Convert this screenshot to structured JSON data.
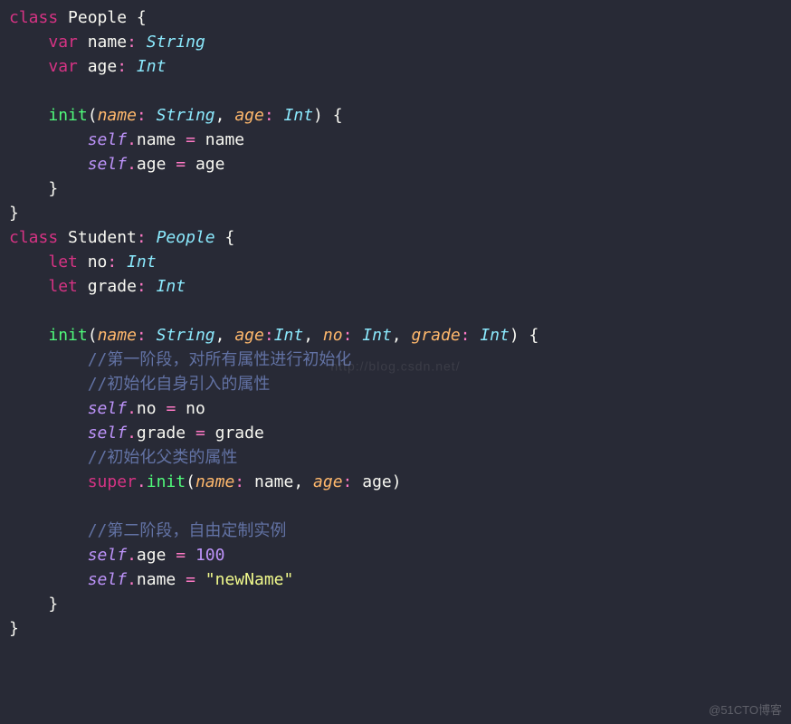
{
  "code": {
    "line1": {
      "class": "class",
      "ident": "People",
      "brace": "{"
    },
    "line2": {
      "kw": "var",
      "name": "name",
      "colon": ":",
      "type": "String"
    },
    "line3": {
      "kw": "var",
      "name": "age",
      "colon": ":",
      "type": "Int"
    },
    "line5": {
      "init": "init",
      "p1": "name",
      "c1": ":",
      "t1": "String",
      "comma1": ",",
      "p2": "age",
      "c2": ":",
      "t2": "Int",
      "brace": "{"
    },
    "line6": {
      "self": "self",
      "dot": ".",
      "prop": "name",
      "eq": "=",
      "val": "name"
    },
    "line7": {
      "self": "self",
      "dot": ".",
      "prop": "age",
      "eq": "=",
      "val": "age"
    },
    "line8": {
      "brace": "}"
    },
    "line9": {
      "brace": "}"
    },
    "line10": {
      "class": "class",
      "ident": "Student",
      "colon": ":",
      "superc": "People",
      "brace": "{"
    },
    "line11": {
      "kw": "let",
      "name": "no",
      "colon": ":",
      "type": "Int"
    },
    "line12": {
      "kw": "let",
      "name": "grade",
      "colon": ":",
      "type": "Int"
    },
    "line14": {
      "init": "init",
      "p1": "name",
      "c1": ":",
      "t1": "String",
      "comma1": ",",
      "p2": "age",
      "c2": ":",
      "t2": "Int",
      "comma2": ",",
      "p3": "no",
      "c3": ":",
      "t3": "Int",
      "comma3": ",",
      "p4": "grade",
      "c4": ":",
      "t4": "Int",
      "brace": "{"
    },
    "line15": {
      "comment": "//第一阶段，对所有属性进行初始化"
    },
    "line16": {
      "comment": "//初始化自身引入的属性"
    },
    "line17": {
      "self": "self",
      "dot": ".",
      "prop": "no",
      "eq": "=",
      "val": "no"
    },
    "line18": {
      "self": "self",
      "dot": ".",
      "prop": "grade",
      "eq": "=",
      "val": "grade"
    },
    "line19": {
      "comment": "//初始化父类的属性"
    },
    "line20": {
      "super": "super",
      "dot": ".",
      "init": "init",
      "p1": "name",
      "c1": ":",
      "v1": "name",
      "comma1": ",",
      "p2": "age",
      "c2": ":",
      "v2": "age"
    },
    "line22": {
      "comment": "//第二阶段，自由定制实例"
    },
    "line23": {
      "self": "self",
      "dot": ".",
      "prop": "age",
      "eq": "=",
      "val": "100"
    },
    "line24": {
      "self": "self",
      "dot": ".",
      "prop": "name",
      "eq": "=",
      "val": "\"newName\""
    },
    "line25": {
      "brace": "}"
    },
    "line26": {
      "brace": "}"
    }
  },
  "watermarks": {
    "center": "http://blog.csdn.net/",
    "bottomRight": "@51CTO博客"
  }
}
